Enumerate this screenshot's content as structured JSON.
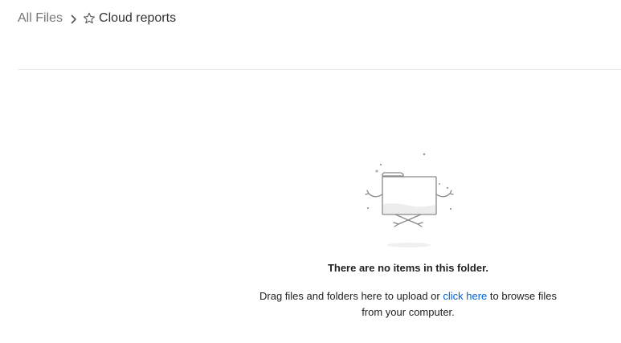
{
  "breadcrumb": {
    "root_label": "All Files",
    "separator_icon": "chevron-right-icon",
    "favorite_icon": "star-outline-icon",
    "current_label": "Cloud reports"
  },
  "empty_state": {
    "illustration": "empty-folder-illustration",
    "title": "There are no items in this folder.",
    "description_before": "Drag files and folders here to upload or ",
    "link_text": "click here",
    "description_after": " to browse files from your computer."
  },
  "colors": {
    "link": "#0061d5",
    "muted_text": "#767676",
    "divider": "#e8e8e8"
  }
}
